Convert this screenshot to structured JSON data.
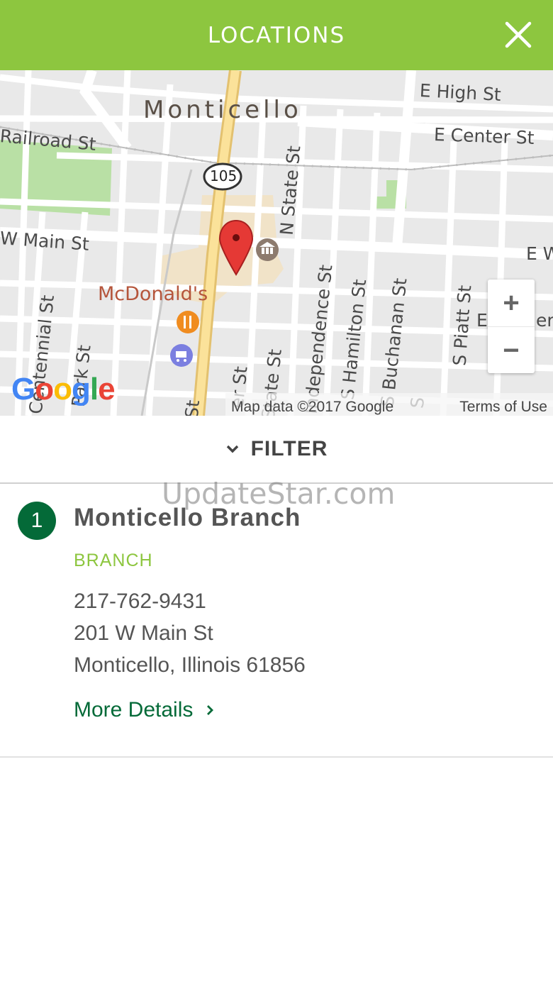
{
  "header": {
    "title": "LOCATIONS",
    "close_icon": "close-icon"
  },
  "map": {
    "city_label": "Monticello",
    "streets": {
      "e_high": "E High St",
      "e_center": "E Center St",
      "railroad": "Railroad St",
      "w_main": "W Main St",
      "e_w": "E W",
      "n_state": "N State St",
      "route": "105",
      "independence": "Independence St",
      "s_hamilton": "S Hamilton St",
      "s_buchanan": "S Buchanan St",
      "s_piatt": "S Piatt St",
      "centennial": "Centennial St",
      "park": "Park St",
      "st_frag": "St",
      "er_st": "er St",
      "state_st": "State St",
      "e_frag": "E",
      "er_frag": "er",
      "s_frag": "S"
    },
    "poi": {
      "mcdonalds": "McDonald's"
    },
    "zoom": {
      "in": "+",
      "out": "−"
    },
    "google_logo": "Google",
    "attribution": "Map data ©2017 Google",
    "terms": "Terms of Use"
  },
  "filter": {
    "label": "FILTER"
  },
  "watermark": "UpdateStar.com",
  "results": [
    {
      "number": "1",
      "name": "Monticello Branch",
      "type": "BRANCH",
      "phone": "217-762-9431",
      "street": "201 W Main St",
      "city_state_zip": "Monticello, Illinois 61856",
      "more_details": "More Details"
    }
  ],
  "colors": {
    "brand_green": "#8dc63f",
    "dark_green": "#046a38",
    "pin_red": "#e53935"
  }
}
